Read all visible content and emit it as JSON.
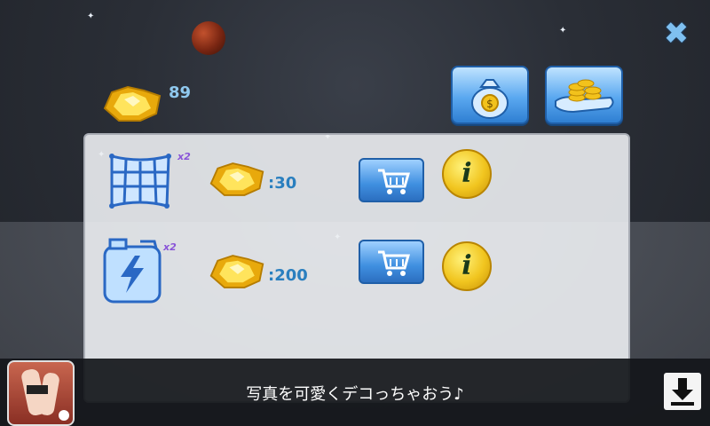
{
  "hud": {
    "gold_count": "89",
    "close_icon": "close-x-icon",
    "buttons": [
      {
        "name": "money-bag-shop",
        "icon": "money-bag-icon"
      },
      {
        "name": "coin-stack-shop",
        "icon": "coin-stack-hand-icon"
      }
    ]
  },
  "shop_items": [
    {
      "item_icon": "net-icon",
      "multiplier": "x2",
      "price": ":30",
      "cart_icon": "cart-icon",
      "info_icon": "info-icon"
    },
    {
      "item_icon": "fuel-can-icon",
      "multiplier": "x2",
      "price": ":200",
      "cart_icon": "cart-icon",
      "info_icon": "info-icon"
    }
  ],
  "info_label": "i",
  "ad": {
    "text": "写真を可愛くデコっちゃおう♪",
    "download_icon": "download-icon"
  },
  "colors": {
    "price_text": "#2a7fbf",
    "multiplier_text": "#8a55d8",
    "gold": "#f2c21c",
    "button_blue": "#3f8fe0"
  }
}
